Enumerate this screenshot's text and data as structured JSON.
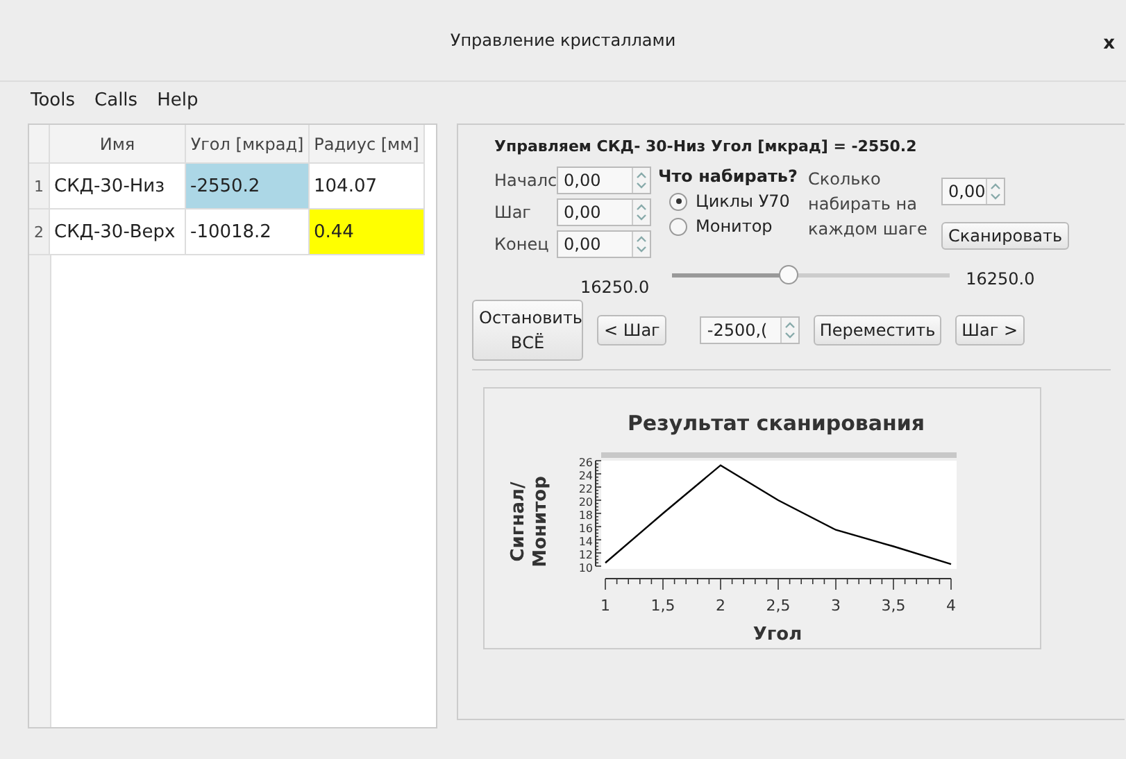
{
  "window": {
    "title": "Управление кристаллами",
    "close": "x"
  },
  "menu": [
    "Tools",
    "Calls",
    "Help"
  ],
  "table": {
    "columns": [
      "Имя",
      "Угол [мкрад]",
      "Радиус [мм]"
    ],
    "rows": [
      {
        "number": "1",
        "cells": [
          {
            "text": "СКД-30-Низ"
          },
          {
            "text": "-2550.2",
            "color": "#acd7e6"
          },
          {
            "text": "104.07"
          }
        ]
      },
      {
        "number": "2",
        "cells": [
          {
            "text": "СКД-30-Верх"
          },
          {
            "text": "-10018.2"
          },
          {
            "text": "0.44",
            "color": "#ffff00"
          }
        ]
      }
    ]
  },
  "control": {
    "heading": "Управляем СКД- 30-Низ Угол [мкрад] = -2550.2",
    "fields": [
      {
        "label": "Началс",
        "value": "0,00"
      },
      {
        "label": "Шаг",
        "value": "0,00"
      },
      {
        "label": "Конец",
        "value": "0,00"
      }
    ],
    "mode_title": "Что набирать?",
    "modes": [
      {
        "label": "Циклы У70",
        "selected": true
      },
      {
        "label": "Монитор",
        "selected": false
      }
    ],
    "count_label": "Сколько набирать на каждом шаге",
    "count_value": "0,00",
    "scan_button": "Сканировать",
    "slider": {
      "min_label": "16250.0",
      "max_label": "16250.0",
      "level": 0.42
    },
    "stop_button": "Остановить ВСЁ",
    "step_back": "< Шаг",
    "position_value": "-2500,(",
    "move_button": "Переместить",
    "step_forward": "Шаг >"
  },
  "chart_data": {
    "type": "line",
    "title": "Результат сканирования",
    "xlabel": "Угол",
    "ylabel": "Сигнал/ Монитор",
    "x": [
      1,
      1.5,
      2,
      2.5,
      3,
      3.5,
      4
    ],
    "series": [
      {
        "color": "#000000",
        "values": [
          10.5,
          18,
          25.3,
          20,
          15.5,
          13,
          10.3
        ]
      }
    ],
    "xlim": [
      1,
      4
    ],
    "ylim": [
      10,
      26
    ],
    "xticks": [
      {
        "value": 1,
        "label": "1"
      },
      {
        "value": 1.5,
        "label": "1,5"
      },
      {
        "value": 2,
        "label": "2"
      },
      {
        "value": 2.5,
        "label": "2,5"
      },
      {
        "value": 3,
        "label": "3"
      },
      {
        "value": 3.5,
        "label": "3,5"
      },
      {
        "value": 4,
        "label": "4"
      }
    ],
    "yticks": [
      10,
      12,
      14,
      16,
      18,
      20,
      22,
      24,
      26
    ]
  }
}
